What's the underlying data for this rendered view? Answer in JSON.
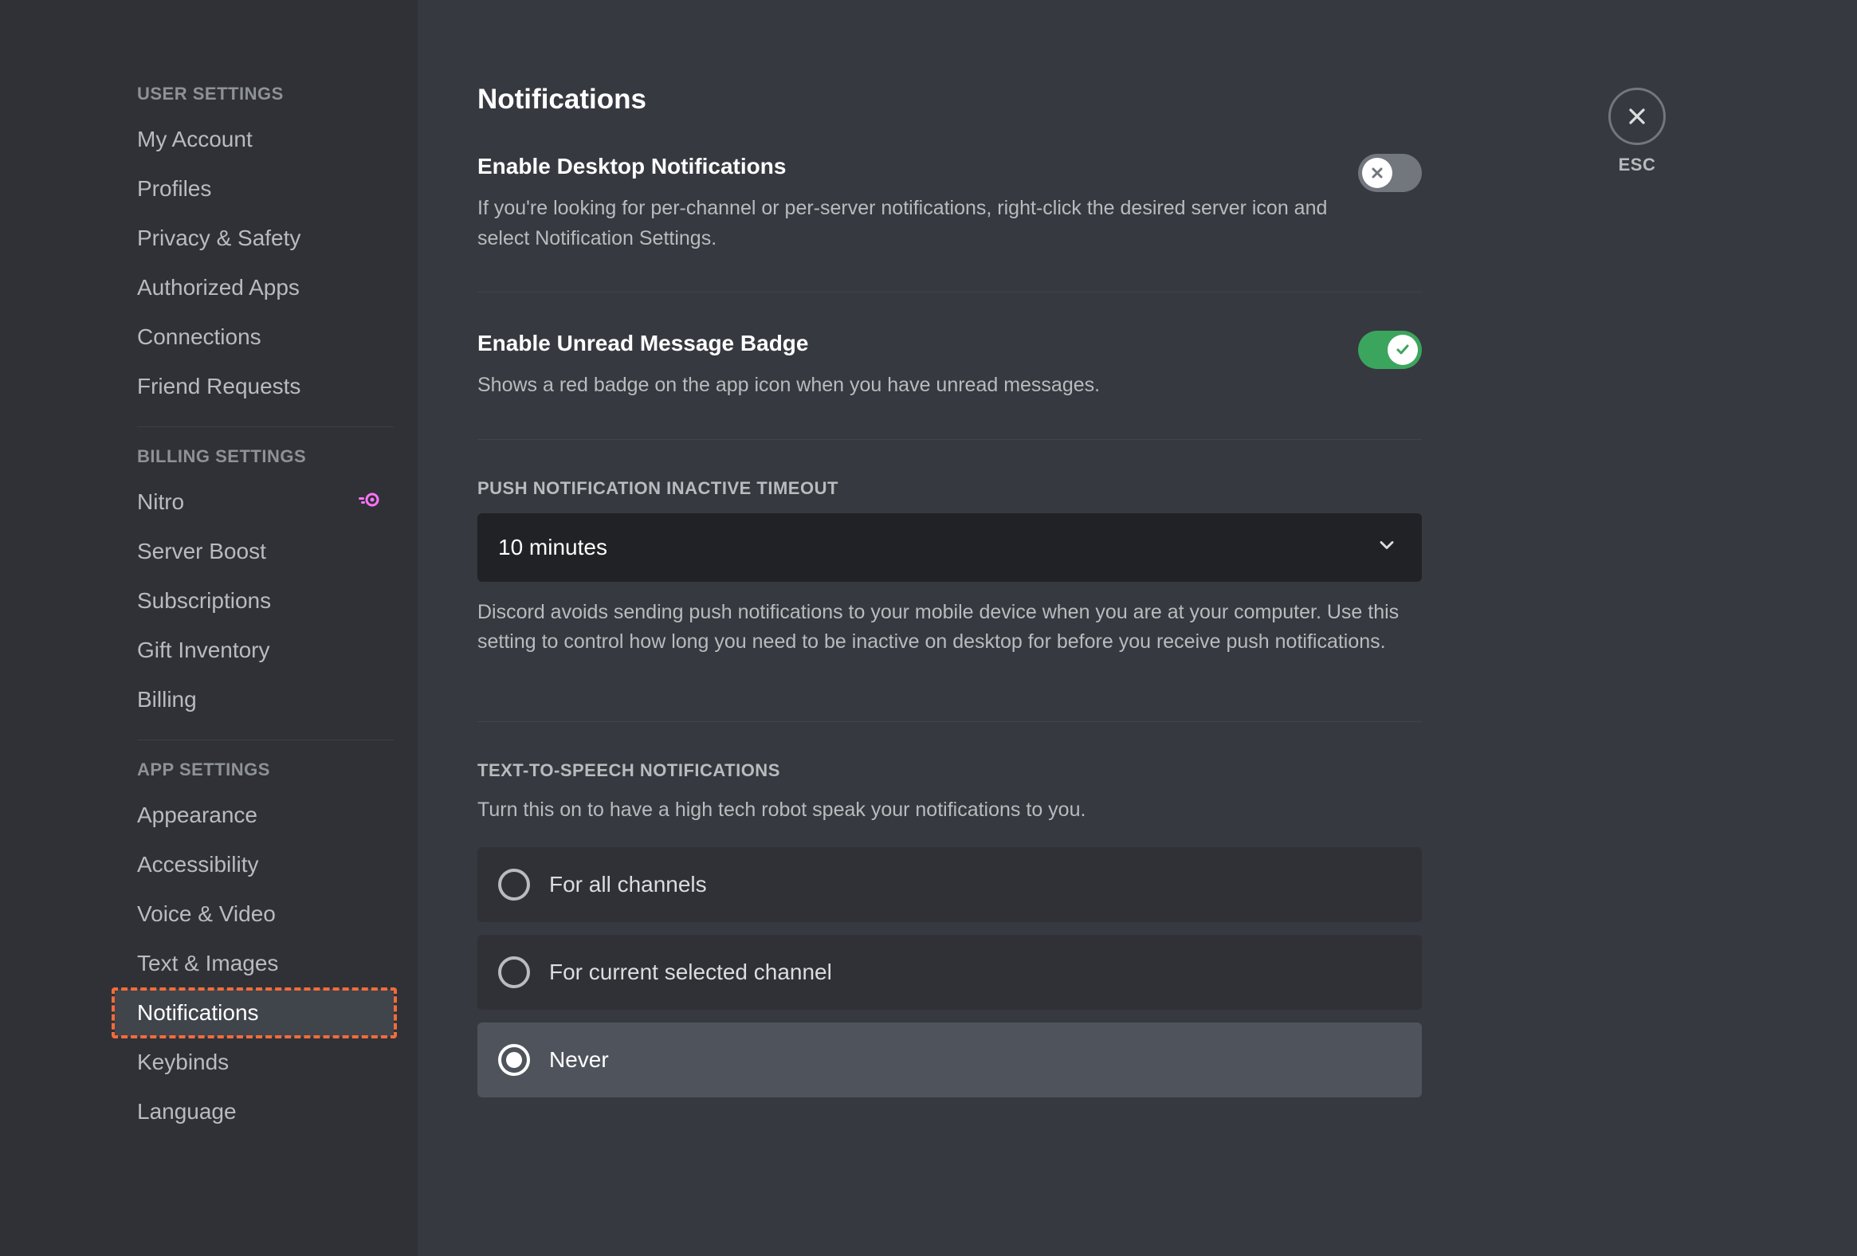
{
  "sidebar": {
    "groups": [
      {
        "header": "USER SETTINGS",
        "items": [
          {
            "label": "My Account"
          },
          {
            "label": "Profiles"
          },
          {
            "label": "Privacy & Safety"
          },
          {
            "label": "Authorized Apps"
          },
          {
            "label": "Connections"
          },
          {
            "label": "Friend Requests"
          }
        ]
      },
      {
        "header": "BILLING SETTINGS",
        "items": [
          {
            "label": "Nitro",
            "badge": "nitro"
          },
          {
            "label": "Server Boost"
          },
          {
            "label": "Subscriptions"
          },
          {
            "label": "Gift Inventory"
          },
          {
            "label": "Billing"
          }
        ]
      },
      {
        "header": "APP SETTINGS",
        "items": [
          {
            "label": "Appearance"
          },
          {
            "label": "Accessibility"
          },
          {
            "label": "Voice & Video"
          },
          {
            "label": "Text & Images"
          },
          {
            "label": "Notifications",
            "active": true,
            "highlighted": true
          },
          {
            "label": "Keybinds"
          },
          {
            "label": "Language"
          }
        ]
      }
    ]
  },
  "page": {
    "title": "Notifications",
    "close_label": "ESC"
  },
  "settings": {
    "desktop": {
      "title": "Enable Desktop Notifications",
      "desc": "If you're looking for per-channel or per-server notifications, right-click the desired server icon and select Notification Settings.",
      "enabled": false
    },
    "unread": {
      "title": "Enable Unread Message Badge",
      "desc": "Shows a red badge on the app icon when you have unread messages.",
      "enabled": true
    },
    "push_timeout": {
      "label": "PUSH NOTIFICATION INACTIVE TIMEOUT",
      "value": "10 minutes",
      "desc": "Discord avoids sending push notifications to your mobile device when you are at your computer. Use this setting to control how long you need to be inactive on desktop for before you receive push notifications."
    },
    "tts": {
      "label": "TEXT-TO-SPEECH NOTIFICATIONS",
      "desc": "Turn this on to have a high tech robot speak your notifications to you.",
      "options": [
        {
          "label": "For all channels",
          "selected": false
        },
        {
          "label": "For current selected channel",
          "selected": false
        },
        {
          "label": "Never",
          "selected": true
        }
      ]
    }
  }
}
